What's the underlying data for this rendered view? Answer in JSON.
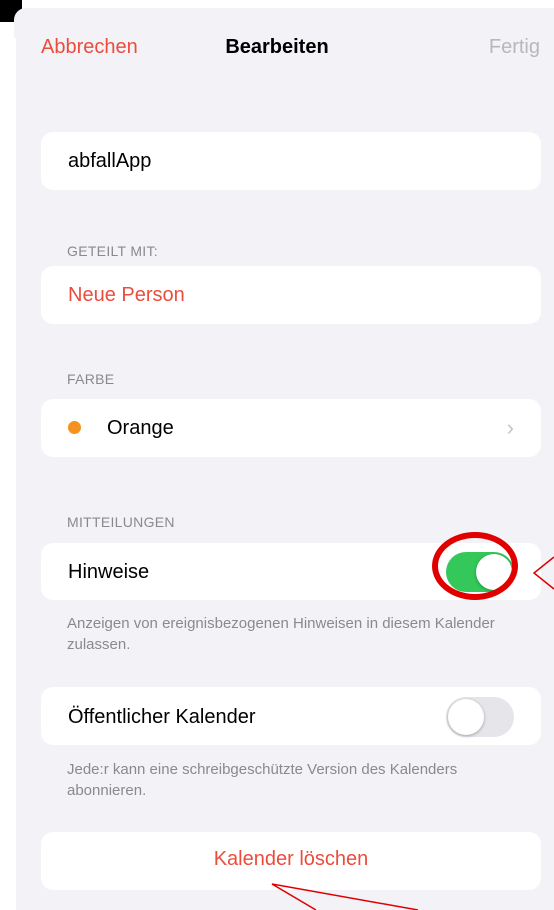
{
  "nav": {
    "cancel": "Abbrechen",
    "title": "Bearbeiten",
    "done": "Fertig"
  },
  "calendar_name": "abfallApp",
  "shared": {
    "section": "GETEILT MIT:",
    "add_person": "Neue Person"
  },
  "color": {
    "section": "FARBE",
    "value": "Orange",
    "swatch": "#f5921e",
    "chevron": "›"
  },
  "notifications": {
    "section": "MITTEILUNGEN",
    "alerts_label": "Hinweise",
    "alerts_enabled": true,
    "alerts_note": "Anzeigen von ereignisbezogenen Hinweisen in diesem Kalender zulassen."
  },
  "public": {
    "label": "Öffentlicher Kalender",
    "enabled": false,
    "note": "Jede:r kann eine schreibgeschützte Version des Kalenders abonnieren."
  },
  "delete": "Kalender löschen",
  "colors": {
    "accent": "#eb4d3d",
    "switch_on": "#34c759",
    "annotation": "#e00000"
  }
}
